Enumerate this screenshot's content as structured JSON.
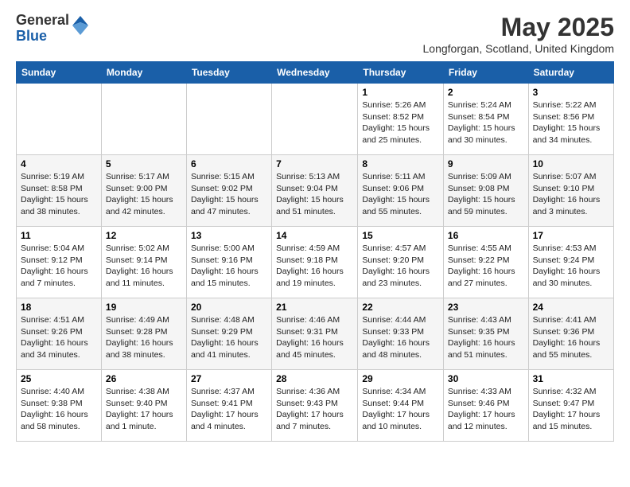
{
  "logo": {
    "general": "General",
    "blue": "Blue"
  },
  "title": {
    "month": "May 2025",
    "location": "Longforgan, Scotland, United Kingdom"
  },
  "weekdays": [
    "Sunday",
    "Monday",
    "Tuesday",
    "Wednesday",
    "Thursday",
    "Friday",
    "Saturday"
  ],
  "weeks": [
    [
      {
        "day": "",
        "info": ""
      },
      {
        "day": "",
        "info": ""
      },
      {
        "day": "",
        "info": ""
      },
      {
        "day": "",
        "info": ""
      },
      {
        "day": "1",
        "info": "Sunrise: 5:26 AM\nSunset: 8:52 PM\nDaylight: 15 hours\nand 25 minutes."
      },
      {
        "day": "2",
        "info": "Sunrise: 5:24 AM\nSunset: 8:54 PM\nDaylight: 15 hours\nand 30 minutes."
      },
      {
        "day": "3",
        "info": "Sunrise: 5:22 AM\nSunset: 8:56 PM\nDaylight: 15 hours\nand 34 minutes."
      }
    ],
    [
      {
        "day": "4",
        "info": "Sunrise: 5:19 AM\nSunset: 8:58 PM\nDaylight: 15 hours\nand 38 minutes."
      },
      {
        "day": "5",
        "info": "Sunrise: 5:17 AM\nSunset: 9:00 PM\nDaylight: 15 hours\nand 42 minutes."
      },
      {
        "day": "6",
        "info": "Sunrise: 5:15 AM\nSunset: 9:02 PM\nDaylight: 15 hours\nand 47 minutes."
      },
      {
        "day": "7",
        "info": "Sunrise: 5:13 AM\nSunset: 9:04 PM\nDaylight: 15 hours\nand 51 minutes."
      },
      {
        "day": "8",
        "info": "Sunrise: 5:11 AM\nSunset: 9:06 PM\nDaylight: 15 hours\nand 55 minutes."
      },
      {
        "day": "9",
        "info": "Sunrise: 5:09 AM\nSunset: 9:08 PM\nDaylight: 15 hours\nand 59 minutes."
      },
      {
        "day": "10",
        "info": "Sunrise: 5:07 AM\nSunset: 9:10 PM\nDaylight: 16 hours\nand 3 minutes."
      }
    ],
    [
      {
        "day": "11",
        "info": "Sunrise: 5:04 AM\nSunset: 9:12 PM\nDaylight: 16 hours\nand 7 minutes."
      },
      {
        "day": "12",
        "info": "Sunrise: 5:02 AM\nSunset: 9:14 PM\nDaylight: 16 hours\nand 11 minutes."
      },
      {
        "day": "13",
        "info": "Sunrise: 5:00 AM\nSunset: 9:16 PM\nDaylight: 16 hours\nand 15 minutes."
      },
      {
        "day": "14",
        "info": "Sunrise: 4:59 AM\nSunset: 9:18 PM\nDaylight: 16 hours\nand 19 minutes."
      },
      {
        "day": "15",
        "info": "Sunrise: 4:57 AM\nSunset: 9:20 PM\nDaylight: 16 hours\nand 23 minutes."
      },
      {
        "day": "16",
        "info": "Sunrise: 4:55 AM\nSunset: 9:22 PM\nDaylight: 16 hours\nand 27 minutes."
      },
      {
        "day": "17",
        "info": "Sunrise: 4:53 AM\nSunset: 9:24 PM\nDaylight: 16 hours\nand 30 minutes."
      }
    ],
    [
      {
        "day": "18",
        "info": "Sunrise: 4:51 AM\nSunset: 9:26 PM\nDaylight: 16 hours\nand 34 minutes."
      },
      {
        "day": "19",
        "info": "Sunrise: 4:49 AM\nSunset: 9:28 PM\nDaylight: 16 hours\nand 38 minutes."
      },
      {
        "day": "20",
        "info": "Sunrise: 4:48 AM\nSunset: 9:29 PM\nDaylight: 16 hours\nand 41 minutes."
      },
      {
        "day": "21",
        "info": "Sunrise: 4:46 AM\nSunset: 9:31 PM\nDaylight: 16 hours\nand 45 minutes."
      },
      {
        "day": "22",
        "info": "Sunrise: 4:44 AM\nSunset: 9:33 PM\nDaylight: 16 hours\nand 48 minutes."
      },
      {
        "day": "23",
        "info": "Sunrise: 4:43 AM\nSunset: 9:35 PM\nDaylight: 16 hours\nand 51 minutes."
      },
      {
        "day": "24",
        "info": "Sunrise: 4:41 AM\nSunset: 9:36 PM\nDaylight: 16 hours\nand 55 minutes."
      }
    ],
    [
      {
        "day": "25",
        "info": "Sunrise: 4:40 AM\nSunset: 9:38 PM\nDaylight: 16 hours\nand 58 minutes."
      },
      {
        "day": "26",
        "info": "Sunrise: 4:38 AM\nSunset: 9:40 PM\nDaylight: 17 hours\nand 1 minute."
      },
      {
        "day": "27",
        "info": "Sunrise: 4:37 AM\nSunset: 9:41 PM\nDaylight: 17 hours\nand 4 minutes."
      },
      {
        "day": "28",
        "info": "Sunrise: 4:36 AM\nSunset: 9:43 PM\nDaylight: 17 hours\nand 7 minutes."
      },
      {
        "day": "29",
        "info": "Sunrise: 4:34 AM\nSunset: 9:44 PM\nDaylight: 17 hours\nand 10 minutes."
      },
      {
        "day": "30",
        "info": "Sunrise: 4:33 AM\nSunset: 9:46 PM\nDaylight: 17 hours\nand 12 minutes."
      },
      {
        "day": "31",
        "info": "Sunrise: 4:32 AM\nSunset: 9:47 PM\nDaylight: 17 hours\nand 15 minutes."
      }
    ]
  ]
}
